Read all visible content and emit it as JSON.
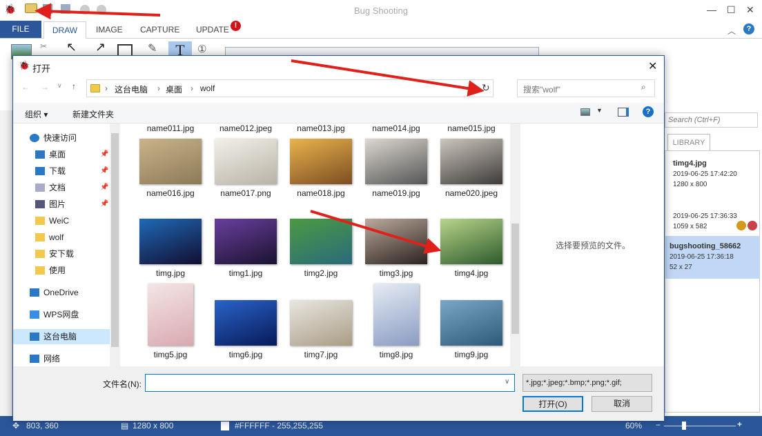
{
  "app": {
    "title": "Bug Shooting",
    "tabs": {
      "file": "FILE",
      "draw": "DRAW",
      "image": "IMAGE",
      "capture": "CAPTURE",
      "update": "UPDATE"
    }
  },
  "right_panel": {
    "search_placeholder": "Search (Ctrl+F)",
    "tab": "LIBRARY",
    "items": [
      {
        "name": "timg4.jpg",
        "date": "2019-06-25 17:42:20",
        "size": "1280 x 800"
      },
      {
        "name": "",
        "date": "2019-06-25 17:36:33",
        "size": "1059 x 582"
      },
      {
        "name": "bugshooting_58662",
        "date": "2019-06-25 17:36:18",
        "size": "52 x 27"
      }
    ]
  },
  "status": {
    "cursor": "803, 360",
    "image_size": "1280 x 800",
    "color": "#FFFFFF - 255,255,255",
    "zoom": "60%"
  },
  "dialog": {
    "title": "打开",
    "breadcrumb": [
      "这台电脑",
      "桌面",
      "wolf"
    ],
    "search_placeholder": "搜索\"wolf\"",
    "organize": "组织 ▾",
    "new_folder": "新建文件夹",
    "nav": [
      {
        "label": "快速访问",
        "type": "star"
      },
      {
        "label": "桌面",
        "type": "desktop",
        "pinned": true
      },
      {
        "label": "下载",
        "type": "download",
        "pinned": true
      },
      {
        "label": "文档",
        "type": "doc",
        "pinned": true
      },
      {
        "label": "图片",
        "type": "pic",
        "pinned": true
      },
      {
        "label": "WeiC",
        "type": "folder"
      },
      {
        "label": "wolf",
        "type": "folder"
      },
      {
        "label": "安下载",
        "type": "folder"
      },
      {
        "label": "使用",
        "type": "folder"
      },
      {
        "label": "OneDrive",
        "type": "cloud"
      },
      {
        "label": "WPS网盘",
        "type": "cloud2"
      },
      {
        "label": "这台电脑",
        "type": "pc",
        "selected": true
      },
      {
        "label": "网络",
        "type": "net"
      }
    ],
    "files_top_row": [
      "name011.jpg",
      "name012.jpeg",
      "name013.jpg",
      "name014.jpg",
      "name015.jpg"
    ],
    "files": [
      {
        "name": "name016.jpg",
        "colors": [
          "#c9b48a",
          "#8c7a57"
        ]
      },
      {
        "name": "name017.png",
        "colors": [
          "#f2f0ea",
          "#b9b3a6"
        ]
      },
      {
        "name": "name018.jpg",
        "colors": [
          "#e9b44c",
          "#7c4d22"
        ]
      },
      {
        "name": "name019.jpg",
        "colors": [
          "#ddd8d0",
          "#555"
        ]
      },
      {
        "name": "name020.jpeg",
        "colors": [
          "#ccc6bd",
          "#3e3a38"
        ]
      },
      {
        "name": "timg.jpg",
        "colors": [
          "#1f6ab7",
          "#120d30"
        ]
      },
      {
        "name": "timg1.jpg",
        "colors": [
          "#6a3f9e",
          "#1a1230"
        ]
      },
      {
        "name": "timg2.jpg",
        "colors": [
          "#4c9a42",
          "#2a6a7b"
        ]
      },
      {
        "name": "timg3.jpg",
        "colors": [
          "#bba99b",
          "#2b2220"
        ]
      },
      {
        "name": "timg4.jpg",
        "colors": [
          "#b8d58a",
          "#2d5a2c"
        ]
      },
      {
        "name": "timg5.jpg",
        "colors": [
          "#f3e6e6",
          "#d9a9b0"
        ]
      },
      {
        "name": "timg6.jpg",
        "colors": [
          "#2a63c9",
          "#071a58"
        ]
      },
      {
        "name": "timg7.jpg",
        "colors": [
          "#e9e7e2",
          "#a99c84"
        ]
      },
      {
        "name": "timg8.jpg",
        "colors": [
          "#e6ecf5",
          "#8b9cc2"
        ]
      },
      {
        "name": "timg9.jpg",
        "colors": [
          "#7aa7c5",
          "#2e5a7a"
        ]
      }
    ],
    "preview_text": "选择要预览的文件。",
    "filename_label": "文件名(N):",
    "filename_value": "",
    "filter": "*.jpg;*.jpeg;*.bmp;*.png;*.gif;",
    "open": "打开(O)",
    "cancel": "取消"
  },
  "colors": {
    "accent": "#2b579a",
    "arrow": "#e0201a"
  }
}
